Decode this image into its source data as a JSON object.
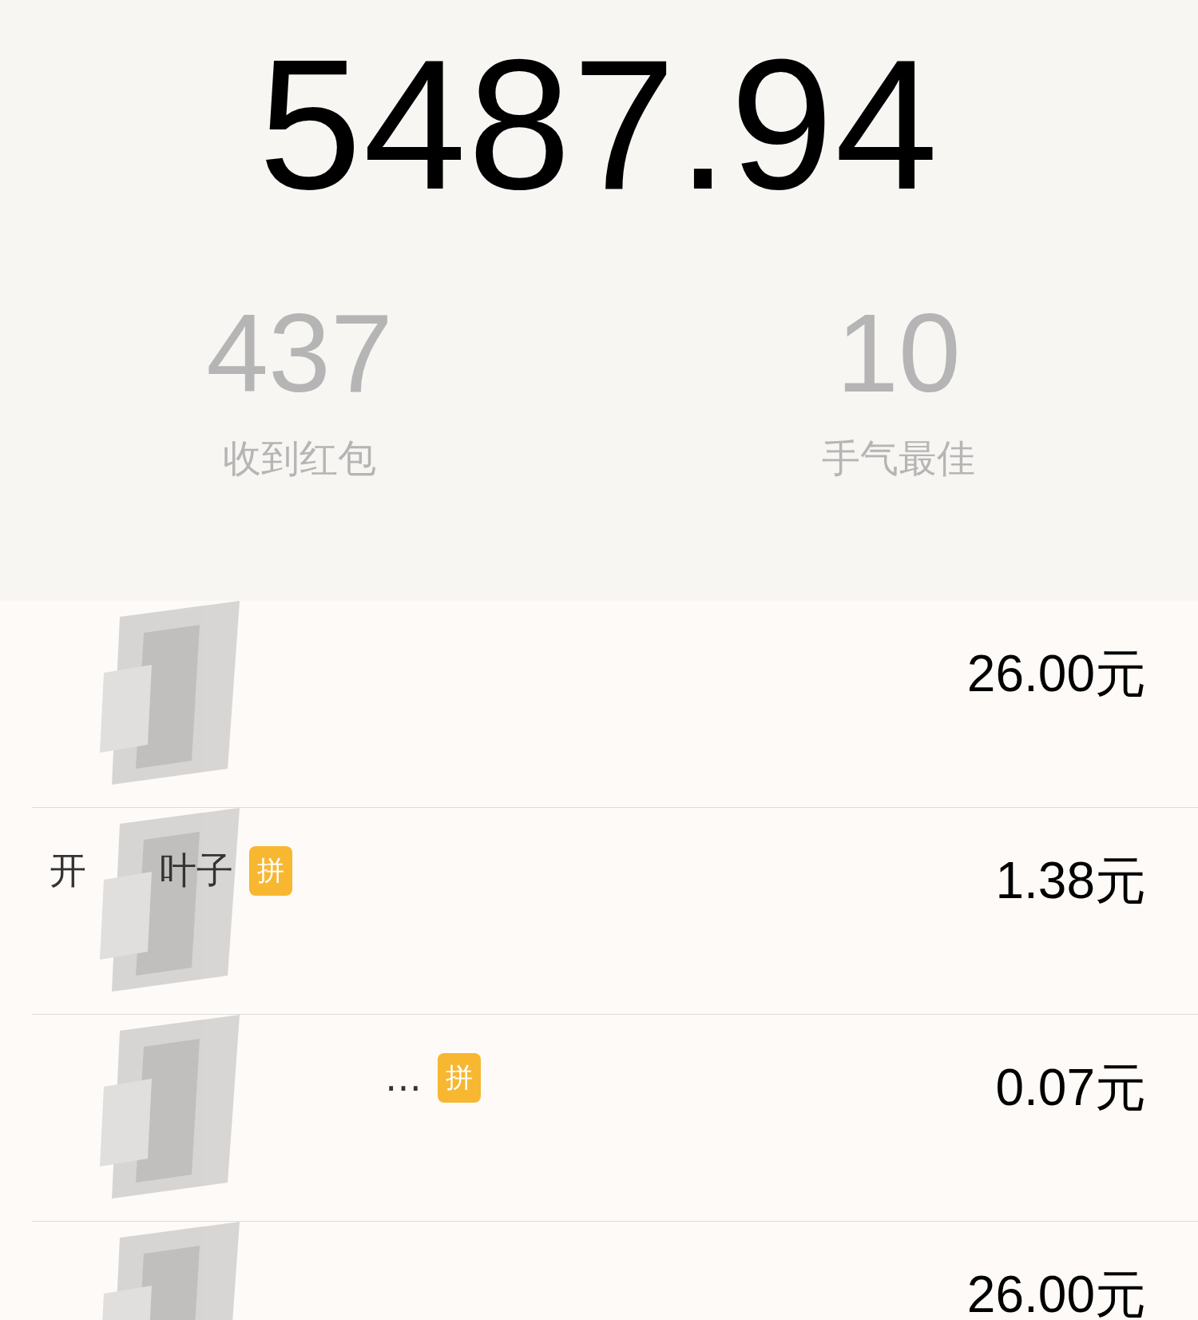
{
  "total": "5487.94",
  "stats": [
    {
      "value": "437",
      "label": "收到红包"
    },
    {
      "value": "10",
      "label": "手气最佳"
    }
  ],
  "rows": [
    {
      "name": "",
      "badge": "",
      "amount": "26.00元"
    },
    {
      "name": "开　　叶子",
      "badge": "拼",
      "amount": "1.38元"
    },
    {
      "name": "…",
      "badge": "拼",
      "amount": "0.07元"
    },
    {
      "name": "",
      "badge": "",
      "amount": "26.00元"
    }
  ]
}
